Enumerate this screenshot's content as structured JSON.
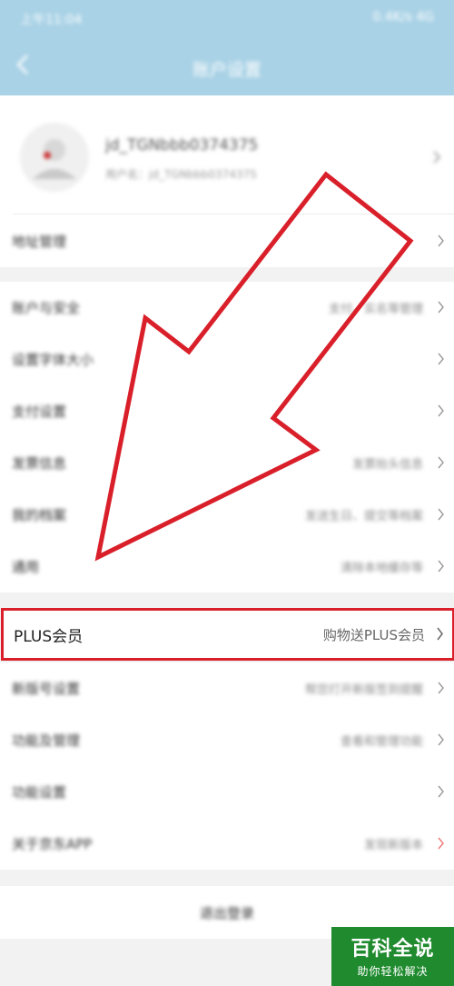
{
  "status_bar": {
    "time": "上午11:04",
    "right": "0.4K/s 4G"
  },
  "header": {
    "title": "账户设置"
  },
  "profile": {
    "username": "jd_TGNbbb0374375",
    "account_label": "用户名：jd_TGNbbb0374375"
  },
  "rows": [
    {
      "label": "地址管理",
      "value": ""
    },
    {
      "label": "账户与安全",
      "value": "支付、实名等管理"
    },
    {
      "label": "设置字体大小",
      "value": ""
    },
    {
      "label": "支付设置",
      "value": ""
    },
    {
      "label": "发票信息",
      "value": "发票抬头信息"
    },
    {
      "label": "我的档案",
      "value": "发送生日、提交等档案"
    },
    {
      "label": "通用",
      "value": "清除本地缓存等"
    },
    {
      "label": "PLUS会员",
      "value": "购物送PLUS会员"
    },
    {
      "label": "新版号设置",
      "value": "帮您打开新版签到提醒"
    },
    {
      "label": "功能及管理",
      "value": "查看和管理功能"
    },
    {
      "label": "功能设置",
      "value": ""
    },
    {
      "label": "关于京东APP",
      "value": "发现新版本"
    }
  ],
  "logout": {
    "label": "退出登录"
  },
  "watermark": {
    "title": "百科全说",
    "subtitle": "助你轻松解决"
  },
  "colors": {
    "header_bg": "#a9d2e6",
    "highlight": "#d9202a",
    "watermark_bg": "#1f8a2e"
  }
}
